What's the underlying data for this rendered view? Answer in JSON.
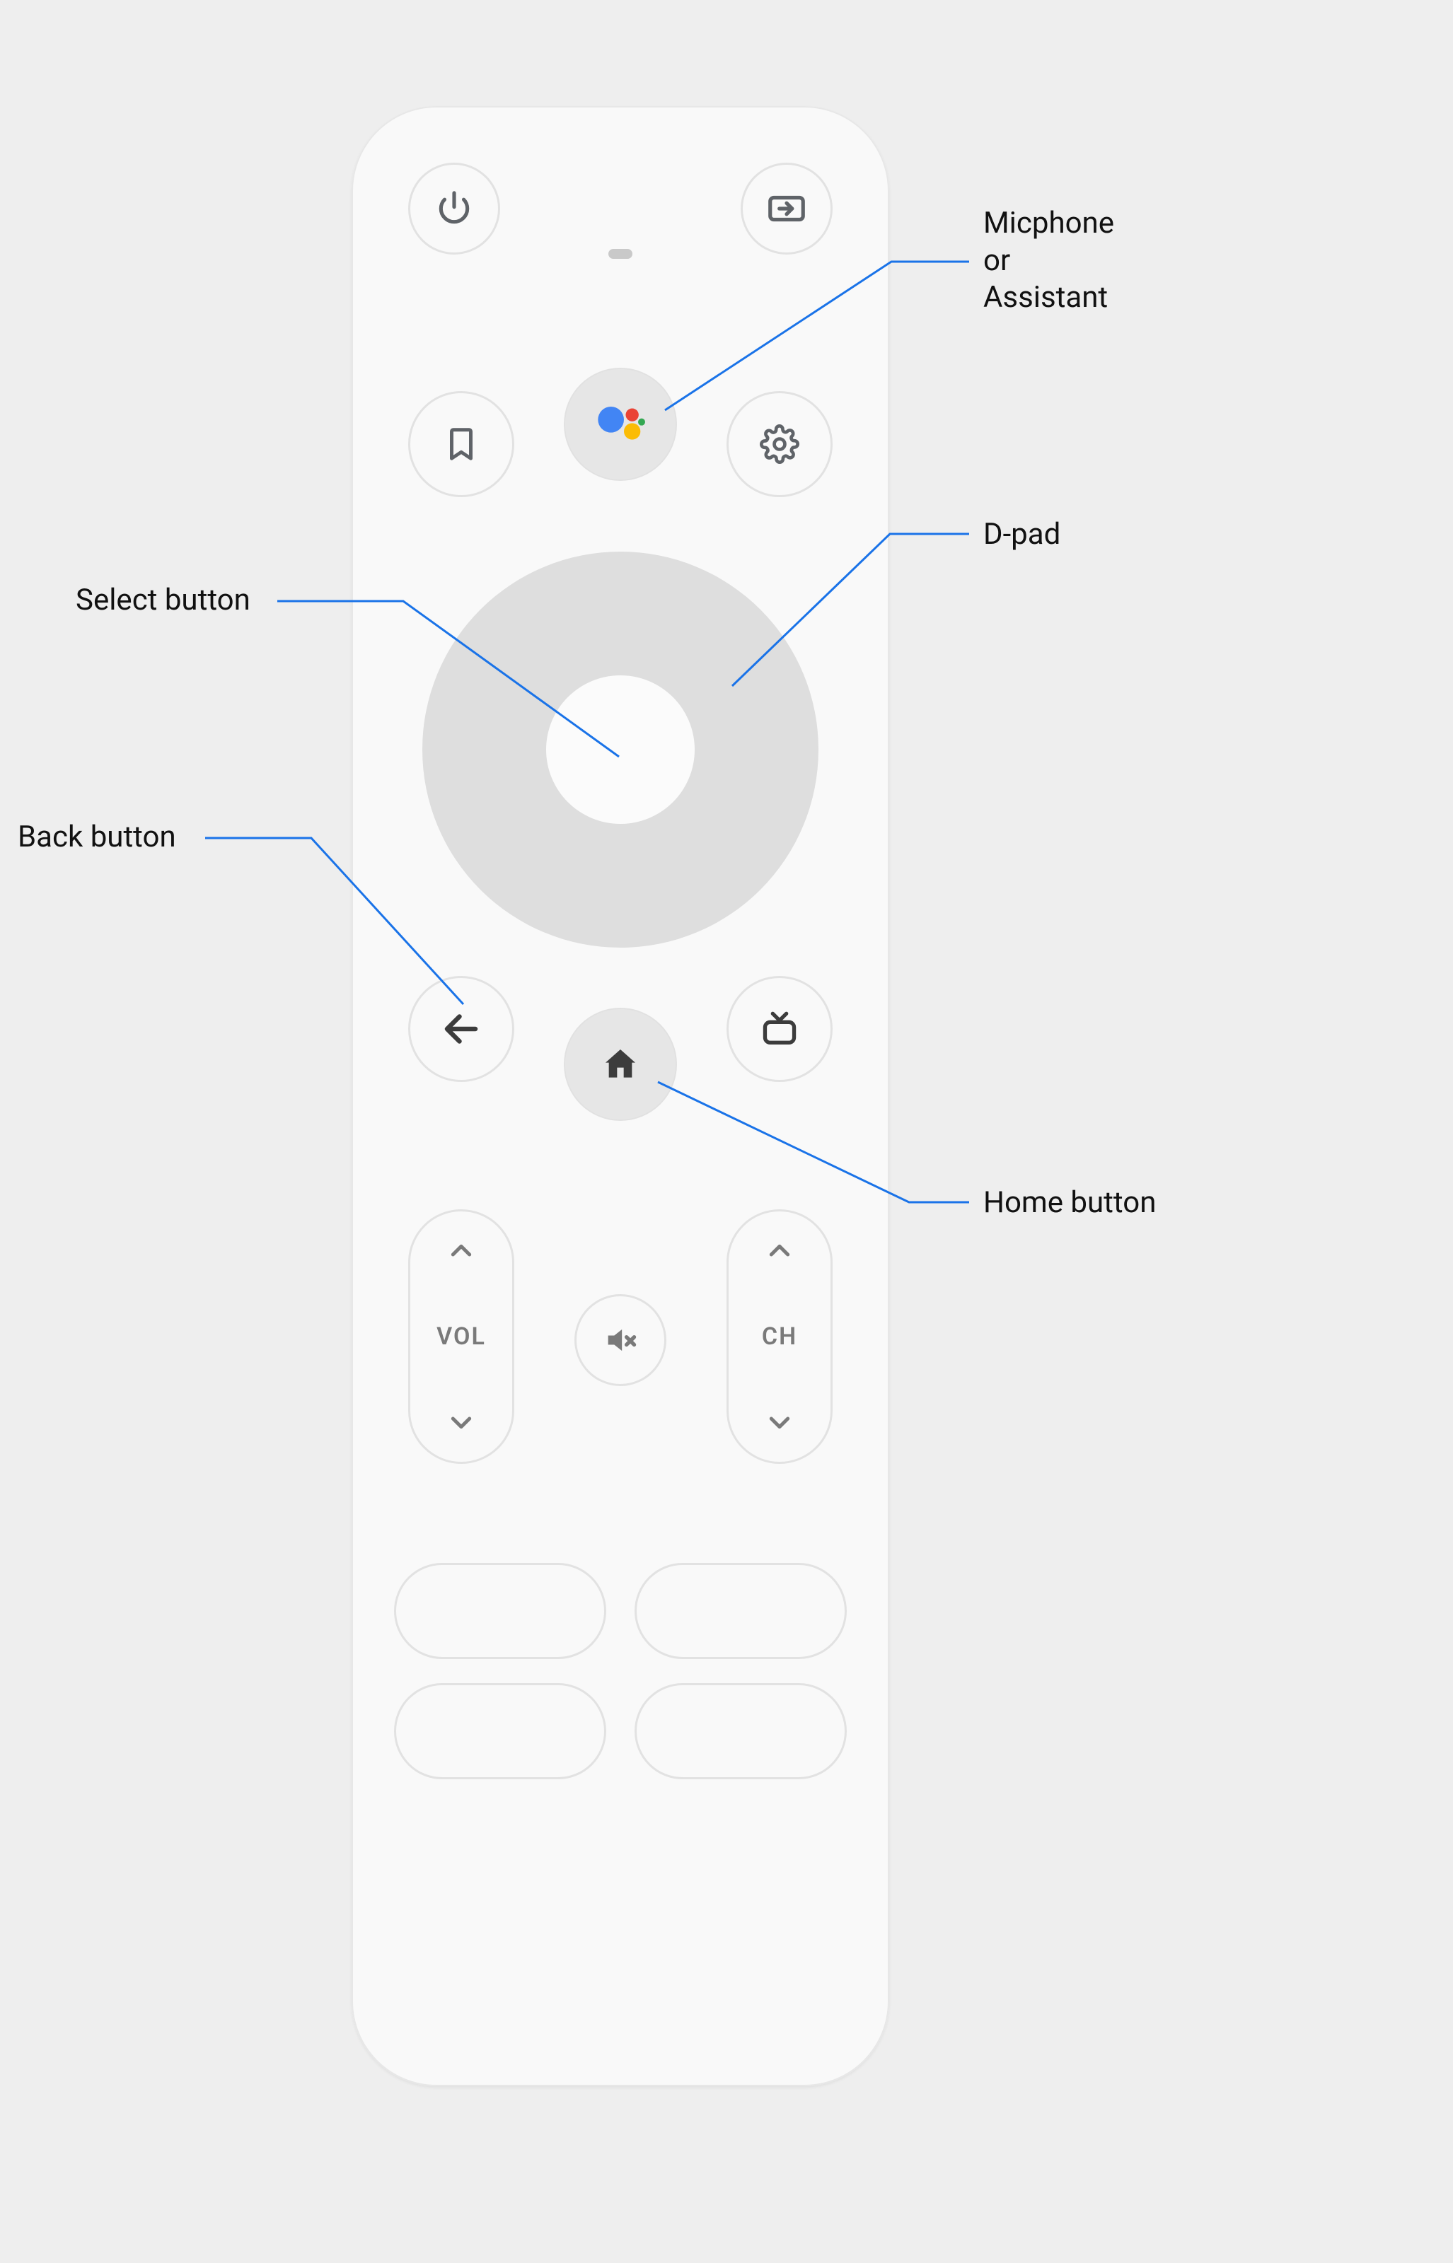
{
  "annotations": {
    "mic": "Micphone\nor\nAssistant",
    "dpad": "D-pad",
    "select": "Select button",
    "back": "Back button",
    "home": "Home button"
  },
  "rockers": {
    "vol_label": "VOL",
    "ch_label": "CH"
  },
  "buttons": {
    "power": "power",
    "input": "input",
    "bookmark": "bookmark",
    "assistant": "assistant",
    "settings": "settings",
    "back": "back",
    "home": "home",
    "tv": "tv",
    "mute": "mute"
  },
  "assistant_colors": {
    "blue": "#4285F4",
    "red": "#EA4335",
    "yellow": "#FBBC05",
    "green": "#34A853"
  }
}
